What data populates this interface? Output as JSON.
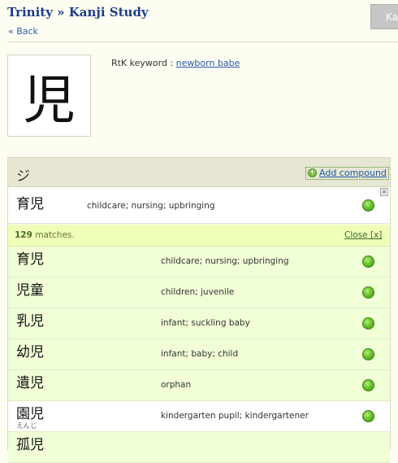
{
  "header": {
    "breadcrumb_root": "Trinity",
    "breadcrumb_sep": "»",
    "breadcrumb_page": "Kanji Study",
    "back_link": "« Back",
    "top_button": "Ka"
  },
  "kanji": {
    "character": "児",
    "keyword_label": "RtK keyword : ",
    "keyword": "newborn babe"
  },
  "panel": {
    "reading": "ジ",
    "add_compound": "Add compound",
    "compound": {
      "word": "育児",
      "meaning": "childcare; nursing; upbringing"
    },
    "close_x": "×",
    "matches_count": "129",
    "matches_label": " matches.",
    "close_label": "Close [x]",
    "results": [
      {
        "word": "育児",
        "meaning": "childcare; nursing; upbringing",
        "furigana": ""
      },
      {
        "word": "児童",
        "meaning": "children; juvenile",
        "furigana": ""
      },
      {
        "word": "乳児",
        "meaning": "infant; suckling baby",
        "furigana": ""
      },
      {
        "word": "幼児",
        "meaning": "infant; baby; child",
        "furigana": ""
      },
      {
        "word": "遺児",
        "meaning": "orphan",
        "furigana": ""
      },
      {
        "word": "園児",
        "meaning": "kindergarten pupil; kindergartener",
        "furigana": "えんじ"
      },
      {
        "word": "孤児",
        "meaning": "",
        "furigana": ""
      }
    ]
  },
  "colors": {
    "accent": "#1c3f86",
    "link": "#2c5aa8",
    "matches_bg": "#efffb8",
    "result_bg": "#f1ffd6",
    "status_green": "#69c22c"
  },
  "icons": {
    "add": "plus-circle-icon",
    "status": "green-dot-icon",
    "close": "close-icon"
  }
}
